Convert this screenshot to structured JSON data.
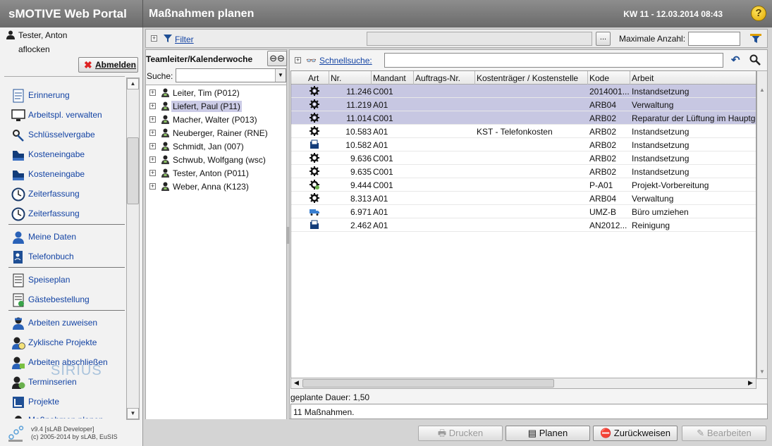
{
  "app": {
    "title": "sMOTIVE Web Portal",
    "page_title": "Maßnahmen planen",
    "week_date": "KW 11 - 12.03.2014 08:43"
  },
  "user": {
    "name": "Tester, Anton",
    "login": "aflocken",
    "logout": "Abmelden"
  },
  "menu": [
    {
      "label": "Erinnerung",
      "icon": "clipboard-icon"
    },
    {
      "label": "Arbeitspl. verwalten",
      "icon": "monitor-icon"
    },
    {
      "label": "Schlüsselvergabe",
      "icon": "key-icon"
    },
    {
      "label": "Kosteneingabe",
      "icon": "cost-icon"
    },
    {
      "label": "Kosteneingabe",
      "icon": "cost-icon"
    },
    {
      "label": "Zeiterfassung",
      "icon": "clock-icon"
    },
    {
      "label": "Zeiterfassung",
      "icon": "clock-icon"
    },
    {
      "label": "Meine Daten",
      "icon": "person-icon"
    },
    {
      "label": "Telefonbuch",
      "icon": "phonebook-icon"
    },
    {
      "label": "Speiseplan",
      "icon": "menu-plan-icon"
    },
    {
      "label": "Gästebestellung",
      "icon": "guest-order-icon"
    },
    {
      "label": "Arbeiten zuweisen",
      "icon": "worker-icon"
    },
    {
      "label": "Zyklische Projekte",
      "icon": "cyclic-icon"
    },
    {
      "label": "Arbeiten abschließen",
      "icon": "finish-icon"
    },
    {
      "label": "Terminserien",
      "icon": "series-icon"
    },
    {
      "label": "Projekte",
      "icon": "project-icon"
    },
    {
      "label": "Maßnahmen planen",
      "icon": "plan-icon"
    }
  ],
  "footer": {
    "version": "v9.4 [sLAB Developer]",
    "copyright": "(c) 2005-2014 by sLAB, EuSIS",
    "logo_text": "SIRIUS"
  },
  "filter": {
    "label": "Filter",
    "more_button": "...",
    "max_label": "Maximale Anzahl:",
    "max_value": ""
  },
  "team": {
    "header": "Teamleiter/Kalenderwoche",
    "search_label": "Suche:",
    "search_value": "",
    "members": [
      {
        "name": "Leiter, Tim (P012)",
        "selected": false
      },
      {
        "name": "Liefert, Paul (P11)",
        "selected": true
      },
      {
        "name": "Macher, Walter (P013)",
        "selected": false
      },
      {
        "name": "Neuberger, Rainer  (RNE)",
        "selected": false
      },
      {
        "name": "Schmidt, Jan (007)",
        "selected": false
      },
      {
        "name": "Schwub, Wolfgang (wsc)",
        "selected": false
      },
      {
        "name": "Tester, Anton (P011)",
        "selected": false
      },
      {
        "name": "Weber, Anna (K123)",
        "selected": false
      }
    ]
  },
  "quicksearch": {
    "label": "Schnellsuche:",
    "value": ""
  },
  "grid": {
    "columns": [
      "Art",
      "Nr.",
      "Mandant",
      "Auftrags-Nr.",
      "Kostenträger / Kostenstelle",
      "Kode",
      "Arbeit"
    ],
    "rows": [
      {
        "icon": "gear-icon",
        "nr": "11.246",
        "mandant": "C001",
        "auftrag": "",
        "kst": "",
        "kode": "2014001...",
        "arbeit": "Instandsetzung",
        "selected": true
      },
      {
        "icon": "gear-icon",
        "nr": "11.219",
        "mandant": "A01",
        "auftrag": "",
        "kst": "",
        "kode": "ARB04",
        "arbeit": "Verwaltung",
        "selected": true
      },
      {
        "icon": "gear-icon",
        "nr": "11.014",
        "mandant": "C001",
        "auftrag": "",
        "kst": "",
        "kode": "ARB02",
        "arbeit": "Reparatur der Lüftung im Hauptgebäude",
        "selected": true
      },
      {
        "icon": "gear-icon",
        "nr": "10.583",
        "mandant": "A01",
        "auftrag": "",
        "kst": "KST - Telefonkosten",
        "kode": "ARB02",
        "arbeit": "Instandsetzung",
        "selected": false
      },
      {
        "icon": "folder-icon",
        "nr": "10.582",
        "mandant": "A01",
        "auftrag": "",
        "kst": "",
        "kode": "ARB02",
        "arbeit": "Instandsetzung",
        "selected": false
      },
      {
        "icon": "gear-icon",
        "nr": "9.636",
        "mandant": "C001",
        "auftrag": "",
        "kst": "",
        "kode": "ARB02",
        "arbeit": "Instandsetzung",
        "selected": false
      },
      {
        "icon": "gear-icon",
        "nr": "9.635",
        "mandant": "C001",
        "auftrag": "",
        "kst": "",
        "kode": "ARB02",
        "arbeit": "Instandsetzung",
        "selected": false
      },
      {
        "icon": "gear-green-icon",
        "nr": "9.444",
        "mandant": "C001",
        "auftrag": "",
        "kst": "",
        "kode": "P-A01",
        "arbeit": "Projekt-Vorbereitung",
        "selected": false
      },
      {
        "icon": "gear-icon",
        "nr": "8.313",
        "mandant": "A01",
        "auftrag": "",
        "kst": "",
        "kode": "ARB04",
        "arbeit": "Verwaltung",
        "selected": false
      },
      {
        "icon": "truck-icon",
        "nr": "6.971",
        "mandant": "A01",
        "auftrag": "",
        "kst": "",
        "kode": "UMZ-B",
        "arbeit": "Büro umziehen",
        "selected": false
      },
      {
        "icon": "folder-icon",
        "nr": "2.462",
        "mandant": "A01",
        "auftrag": "",
        "kst": "",
        "kode": "AN2012...",
        "arbeit": "Reinigung",
        "selected": false
      }
    ]
  },
  "status": {
    "duration": "geplante Dauer: 1,50",
    "count": "11 Maßnahmen."
  },
  "buttons": {
    "print": "Drucken",
    "plan": "Planen",
    "reject": "Zurückweisen",
    "edit": "Bearbeiten"
  },
  "colors": {
    "selection": "#c7c7e2",
    "link": "#1444a4",
    "titlebar": "#7a7a7a"
  }
}
